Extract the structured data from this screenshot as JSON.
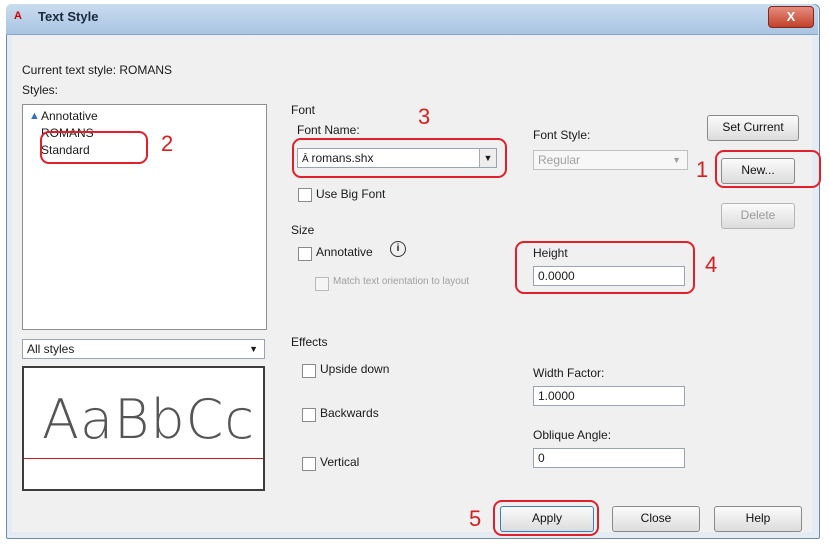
{
  "window": {
    "title": "Text Style",
    "close_glyph": "X",
    "app_icon": "A"
  },
  "current_style": "Current text style:  ROMANS",
  "styles": {
    "label": "Styles:",
    "items": [
      "Annotative",
      "ROMANS",
      "Standard"
    ],
    "filter": "All styles"
  },
  "preview": {
    "text": "AaBbCc"
  },
  "font": {
    "group": "Font",
    "name_label": "Font Name:",
    "name_value": "romans.shx",
    "style_label": "Font Style:",
    "style_value": "Regular",
    "big_font": "Use Big Font"
  },
  "size": {
    "group": "Size",
    "annotative": "Annotative",
    "match": "Match text orientation to layout",
    "height_label": "Height",
    "height_value": "0.0000"
  },
  "effects": {
    "group": "Effects",
    "upside_down": "Upside down",
    "backwards": "Backwards",
    "vertical": "Vertical",
    "width_label": "Width Factor:",
    "width_value": "1.0000",
    "oblique_label": "Oblique Angle:",
    "oblique_value": "0"
  },
  "buttons": {
    "set_current": "Set Current",
    "new": "New...",
    "delete": "Delete",
    "apply": "Apply",
    "close": "Close",
    "help": "Help"
  },
  "callouts": {
    "n1": "1",
    "n2": "2",
    "n3": "3",
    "n4": "4",
    "n5": "5"
  },
  "colors": {
    "callout": "#e0202a",
    "titlebar": "#bcd3ec"
  }
}
